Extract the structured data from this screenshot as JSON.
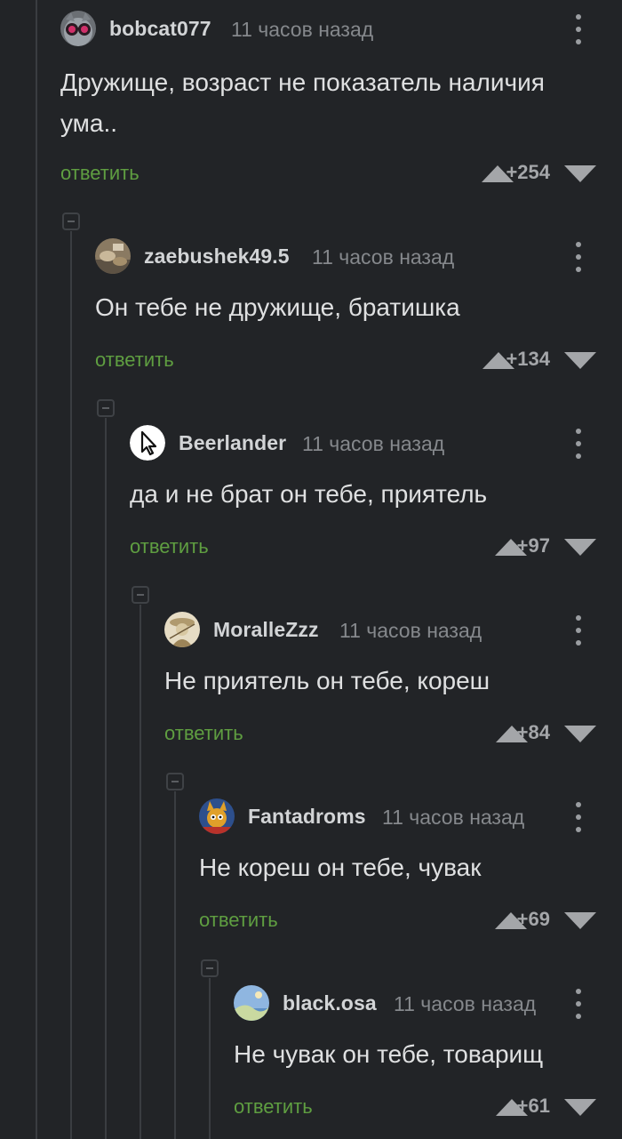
{
  "comments": [
    {
      "username": "bobcat077",
      "time": "11 часов назад",
      "text": "Дружище, возраст не показатель наличия ума..",
      "reply": "ответить",
      "score": "+254",
      "avatar_icon": "cat-goggles-avatar-icon"
    },
    {
      "username": "zaebushek49.5",
      "time": "11 часов назад",
      "text": "Он тебе не дружище, братишка",
      "reply": "ответить",
      "score": "+134",
      "avatar_icon": "photo-avatar-icon"
    },
    {
      "username": "Beerlander",
      "time": "11 часов назад",
      "text": "да и не брат он тебе, приятель",
      "reply": "ответить",
      "score": "+97",
      "avatar_icon": "cursor-avatar-icon"
    },
    {
      "username": "MoralleZzz",
      "time": "11 часов назад",
      "text": "Не приятель он тебе, кореш",
      "reply": "ответить",
      "score": "+84",
      "avatar_icon": "sketch-avatar-icon"
    },
    {
      "username": "Fantadroms",
      "time": "11 часов назад",
      "text": "Не кореш он тебе, чувак",
      "reply": "ответить",
      "score": "+69",
      "avatar_icon": "cartoon-avatar-icon"
    },
    {
      "username": "black.osa",
      "time": "11 часов назад",
      "text": "Не чувак он тебе, товарищ",
      "reply": "ответить",
      "score": "+61",
      "avatar_icon": "landscape-avatar-icon"
    }
  ],
  "colors": {
    "background": "#222427",
    "reply_link": "#5f9e41",
    "thread_line": "#3a3d41",
    "vote_icon": "#a4a6a9"
  }
}
